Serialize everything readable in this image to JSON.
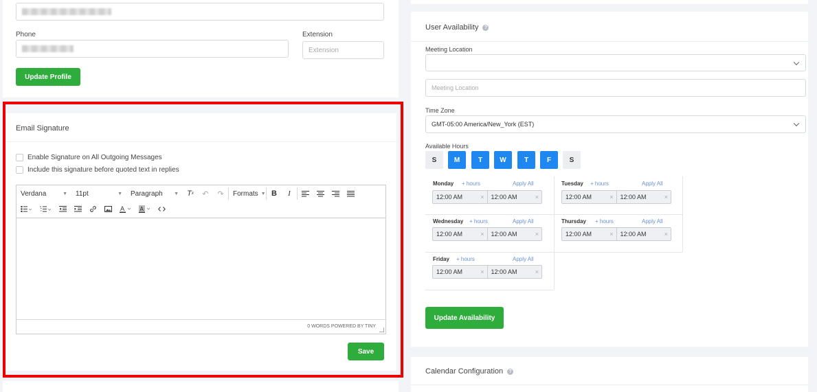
{
  "profile": {
    "phone_label": "Phone",
    "extension_label": "Extension",
    "extension_placeholder": "Extension",
    "update_button": "Update Profile"
  },
  "signature": {
    "title": "Email Signature",
    "checkbox_enable": "Enable Signature on All Outgoing Messages",
    "checkbox_include": "Include this signature before quoted text in replies",
    "toolbar": {
      "font": "Verdana",
      "size": "11pt",
      "block": "Paragraph",
      "formats": "Formats",
      "bold": "B",
      "italic": "I"
    },
    "status": "0 WORDS POWERED BY TINY",
    "save_button": "Save"
  },
  "availability": {
    "title": "User Availability",
    "meeting_location_label": "Meeting Location",
    "meeting_location_placeholder": "Meeting Location",
    "timezone_label": "Time Zone",
    "timezone_value": "GMT-05:00 America/New_York (EST)",
    "available_hours_label": "Available Hours",
    "days": [
      {
        "label": "S",
        "active": false
      },
      {
        "label": "M",
        "active": true
      },
      {
        "label": "T",
        "active": true
      },
      {
        "label": "W",
        "active": true
      },
      {
        "label": "T",
        "active": true
      },
      {
        "label": "F",
        "active": true
      },
      {
        "label": "S",
        "active": false
      }
    ],
    "add_hours": "+ hours",
    "apply_all": "Apply All",
    "slots": [
      {
        "day": "Monday",
        "start": "12:00 AM",
        "end": "12:00 AM"
      },
      {
        "day": "Tuesday",
        "start": "12:00 AM",
        "end": "12:00 AM"
      },
      {
        "day": "Wednesday",
        "start": "12:00 AM",
        "end": "12:00 AM"
      },
      {
        "day": "Thursday",
        "start": "12:00 AM",
        "end": "12:00 AM"
      },
      {
        "day": "Friday",
        "start": "12:00 AM",
        "end": "12:00 AM"
      }
    ],
    "update_button": "Update Availability"
  },
  "calendar": {
    "title": "Calendar Configuration"
  },
  "colors": {
    "accent_green": "#2fad3c",
    "day_active_blue": "#1e88f0",
    "highlight_red": "#ee0000"
  }
}
